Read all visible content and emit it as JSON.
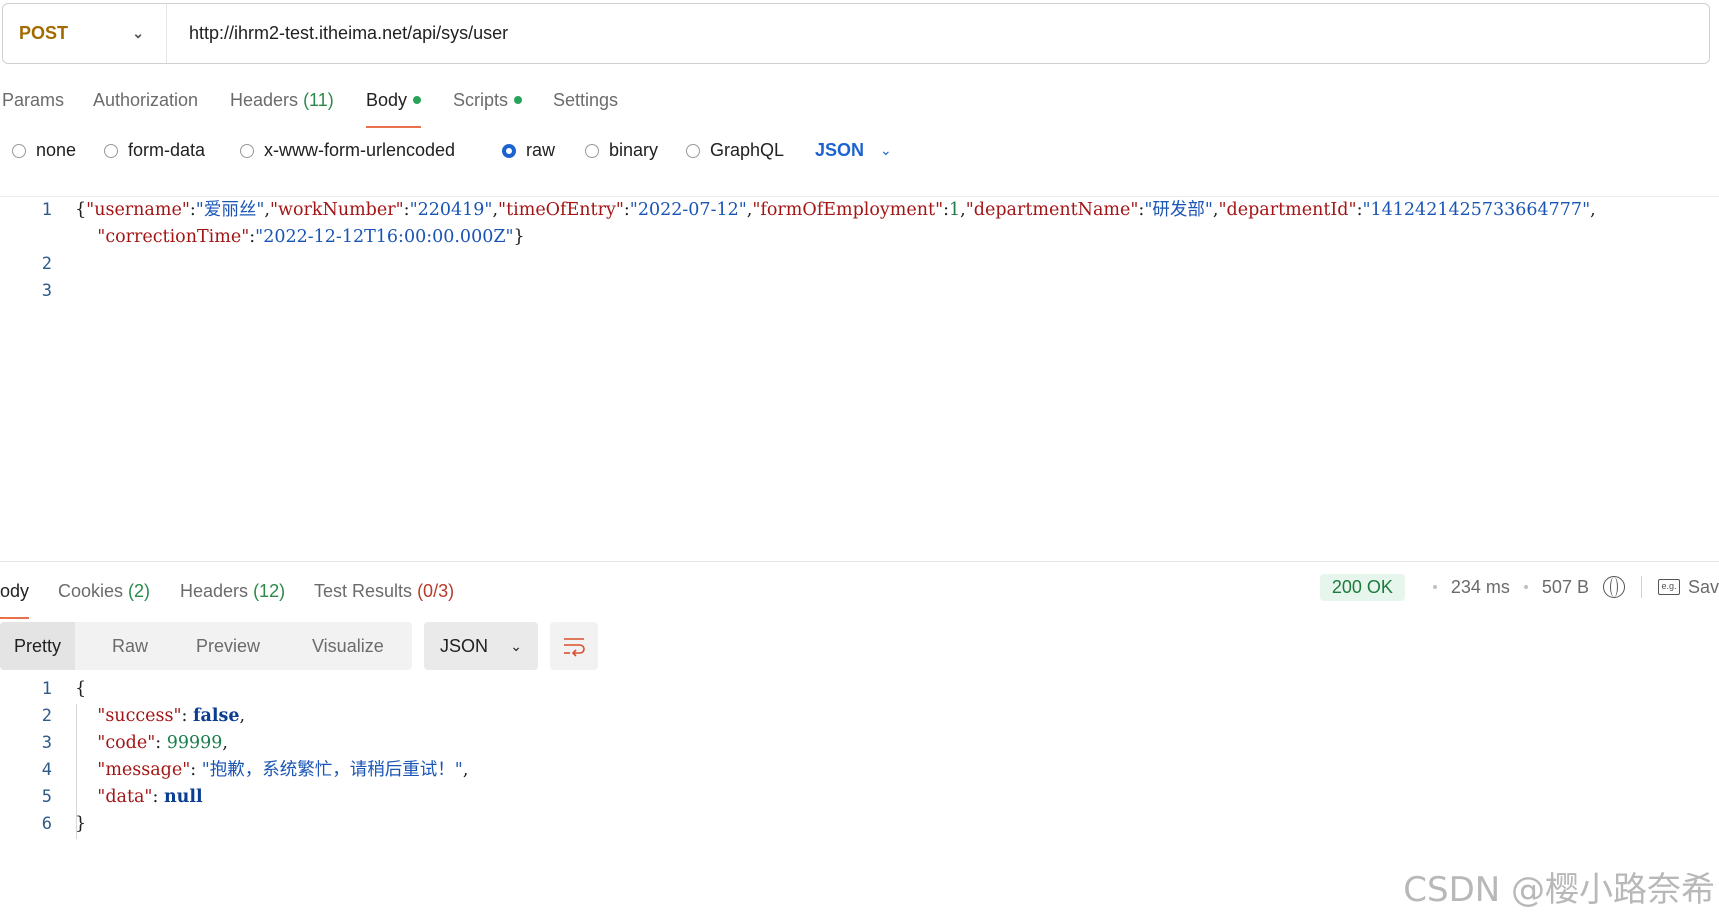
{
  "request": {
    "method": "POST",
    "url": "http://ihrm2-test.itheima.net/api/sys/user"
  },
  "request_tabs": [
    {
      "label": "Params"
    },
    {
      "label": "Authorization"
    },
    {
      "label": "Headers",
      "count": "(11)"
    },
    {
      "label": "Body"
    },
    {
      "label": "Scripts"
    },
    {
      "label": "Settings"
    }
  ],
  "body_options": [
    {
      "label": "none"
    },
    {
      "label": "form-data"
    },
    {
      "label": "x-www-form-urlencoded"
    },
    {
      "label": "raw"
    },
    {
      "label": "binary"
    },
    {
      "label": "GraphQL"
    }
  ],
  "body_format": "JSON",
  "request_body": {
    "line_numbers": [
      "1",
      "",
      "2",
      "3"
    ],
    "username_key": "\"username\"",
    "username_val": "\"爱丽丝\"",
    "worknumber_key": "\"workNumber\"",
    "worknumber_val": "\"220419\"",
    "entry_key": "\"timeOfEntry\"",
    "entry_val": "\"2022-07-12\"",
    "employment_key": "\"formOfEmployment\"",
    "employment_val": "1",
    "deptname_key": "\"departmentName\"",
    "deptname_val": "\"研发部\"",
    "deptid_key": "\"departmentId\"",
    "deptid_val": "\"1412421425733664777\"",
    "correction_key": "\"correctionTime\"",
    "correction_val": "\"2022-12-12T16:00:00.000Z\""
  },
  "response_tabs": [
    {
      "label": "ody"
    },
    {
      "label": "Cookies",
      "count": "(2)"
    },
    {
      "label": "Headers",
      "count": "(12)"
    },
    {
      "label": "Test Results",
      "count": "(0/3)"
    }
  ],
  "status": {
    "code": "200 OK",
    "time": "234 ms",
    "size": "507 B",
    "save_label": "Sav"
  },
  "view_modes": [
    "Pretty",
    "Raw",
    "Preview",
    "Visualize"
  ],
  "response_format": "JSON",
  "response_body": {
    "line_numbers": [
      "1",
      "2",
      "3",
      "4",
      "5",
      "6"
    ],
    "success_key": "\"success\"",
    "success_val": "false",
    "code_key": "\"code\"",
    "code_val": "99999",
    "message_key": "\"message\"",
    "message_val": "\"抱歉，系统繁忙，请稍后重试！\"",
    "data_key": "\"data\"",
    "data_val": "null"
  },
  "watermark": "CSDN @樱小路奈希",
  "colors": {
    "method": "#a36a00",
    "accent": "#e8704a",
    "link_blue": "#1c63d1",
    "status_green": "#1e7a3e",
    "json_key": "#a31515",
    "json_string": "#1a55b5"
  }
}
